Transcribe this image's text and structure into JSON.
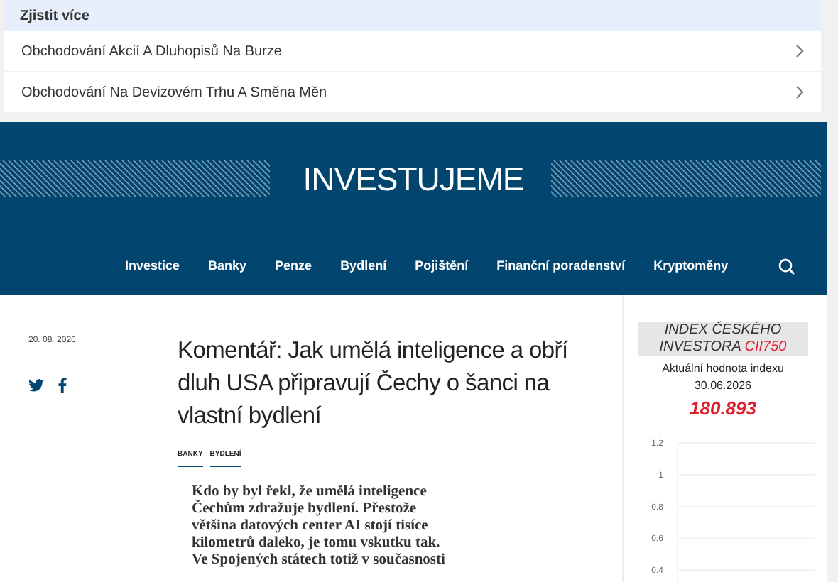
{
  "learn_more": {
    "title": "Zjistit více",
    "items": [
      {
        "label": "Obchodování Akcií A Dluhopisů Na Burze"
      },
      {
        "label": "Obchodování Na Devizovém Trhu A Směna Měn"
      }
    ]
  },
  "header": {
    "logo": "INVESTUJEME",
    "nav": [
      {
        "label": "Investice"
      },
      {
        "label": "Banky"
      },
      {
        "label": "Penze"
      },
      {
        "label": "Bydlení"
      },
      {
        "label": "Pojištění"
      },
      {
        "label": "Finanční poradenství"
      },
      {
        "label": "Kryptoměny"
      }
    ]
  },
  "article": {
    "date": "20. 08. 2026",
    "title": "Komentář: Jak umělá inteligence a obří dluh USA připravují Čechy o šanci na vlastní bydlení",
    "tags": [
      "BANKY",
      "BYDLENÍ"
    ],
    "perex": "Kdo by byl řekl, že umělá inteligence Čechům zdražuje bydlení. Přestože většina datových center AI stojí tisíce kilometrů daleko, je tomu vskutku tak. Ve Spojených státech totiž v současnosti"
  },
  "index_widget": {
    "title": "INDEX ČESKÉHO INVESTORA",
    "code": "CII750",
    "label": "Aktuální hodnota indexu",
    "date": "30.06.2026",
    "value": "180.893",
    "axis_labels": [
      "1.2",
      "1",
      "0.8",
      "0.6",
      "0.4"
    ]
  }
}
